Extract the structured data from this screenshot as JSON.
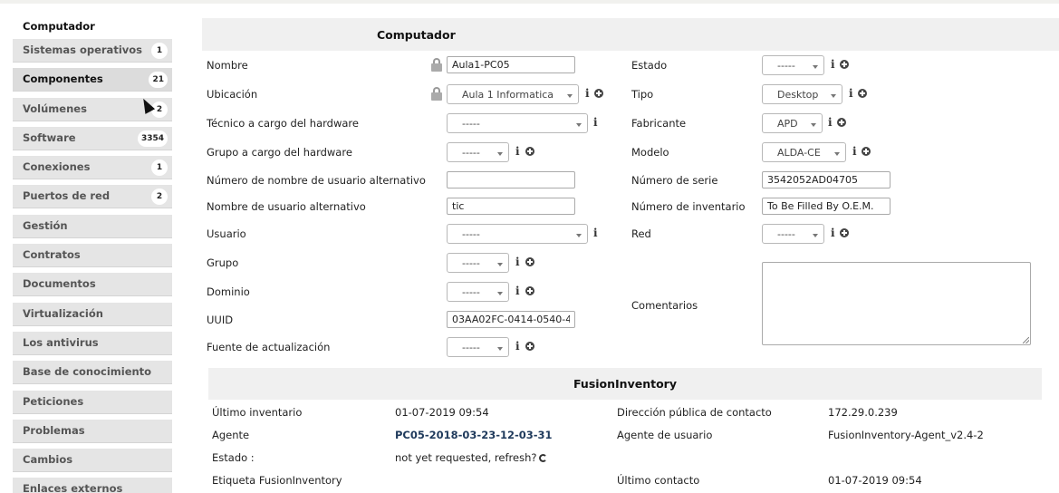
{
  "sidebar": {
    "title": "Computador",
    "items": [
      {
        "label": "Sistemas operativos",
        "badge": "1"
      },
      {
        "label": "Componentes",
        "badge": "21"
      },
      {
        "label": "Volúmenes",
        "badge": "2"
      },
      {
        "label": "Software",
        "badge": "3354"
      },
      {
        "label": "Conexiones",
        "badge": "1"
      },
      {
        "label": "Puertos de red",
        "badge": "2"
      },
      {
        "label": "Gestión"
      },
      {
        "label": "Contratos"
      },
      {
        "label": "Documentos"
      },
      {
        "label": "Virtualización"
      },
      {
        "label": "Los antivirus"
      },
      {
        "label": "Base de conocimiento"
      },
      {
        "label": "Peticiones"
      },
      {
        "label": "Problemas"
      },
      {
        "label": "Cambios"
      },
      {
        "label": "Enlaces externos"
      }
    ]
  },
  "form": {
    "title": "Computador",
    "nombre": {
      "label": "Nombre",
      "value": "Aula1-PC05"
    },
    "ubicacion": {
      "label": "Ubicación",
      "value": "Aula 1 Informatica"
    },
    "tecnico": {
      "label": "Técnico a cargo del hardware",
      "value": "-----"
    },
    "grupo_hw": {
      "label": "Grupo a cargo del hardware",
      "value": "-----"
    },
    "num_usuario_alt": {
      "label": "Número de nombre de usuario alternativo",
      "value": ""
    },
    "usuario_alt": {
      "label": "Nombre de usuario alternativo",
      "value": "tic"
    },
    "usuario": {
      "label": "Usuario",
      "value": "-----"
    },
    "grupo": {
      "label": "Grupo",
      "value": "-----"
    },
    "dominio": {
      "label": "Dominio",
      "value": "-----"
    },
    "uuid": {
      "label": "UUID",
      "value": "03AA02FC-0414-0540-4"
    },
    "fuente": {
      "label": "Fuente de actualización",
      "value": "-----"
    },
    "estado": {
      "label": "Estado",
      "value": "-----"
    },
    "tipo": {
      "label": "Tipo",
      "value": "Desktop"
    },
    "fabricante": {
      "label": "Fabricante",
      "value": "APD"
    },
    "modelo": {
      "label": "Modelo",
      "value": "ALDA-CE"
    },
    "serie": {
      "label": "Número de serie",
      "value": "3542052AD04705"
    },
    "inventario": {
      "label": "Número de inventario",
      "value": "To Be Filled By O.E.M."
    },
    "red": {
      "label": "Red",
      "value": "-----"
    },
    "comentarios": {
      "label": "Comentarios",
      "value": ""
    }
  },
  "fusion": {
    "title": "FusionInventory",
    "ultimo_inventario": {
      "label": "Último inventario",
      "value": "01-07-2019 09:54"
    },
    "direccion": {
      "label": "Dirección pública de contacto",
      "value": "172.29.0.239"
    },
    "agente": {
      "label": "Agente",
      "value": "PC05-2018-03-23-12-03-31"
    },
    "agente_usuario": {
      "label": "Agente de usuario",
      "value": "FusionInventory-Agent_v2.4-2"
    },
    "estado": {
      "label": "Estado :",
      "value": "not yet requested, refresh?"
    },
    "etiqueta": {
      "label": "Etiqueta FusionInventory",
      "value": ""
    },
    "ultimo_contacto": {
      "label": "Último contacto",
      "value": "01-07-2019 09:54"
    }
  }
}
